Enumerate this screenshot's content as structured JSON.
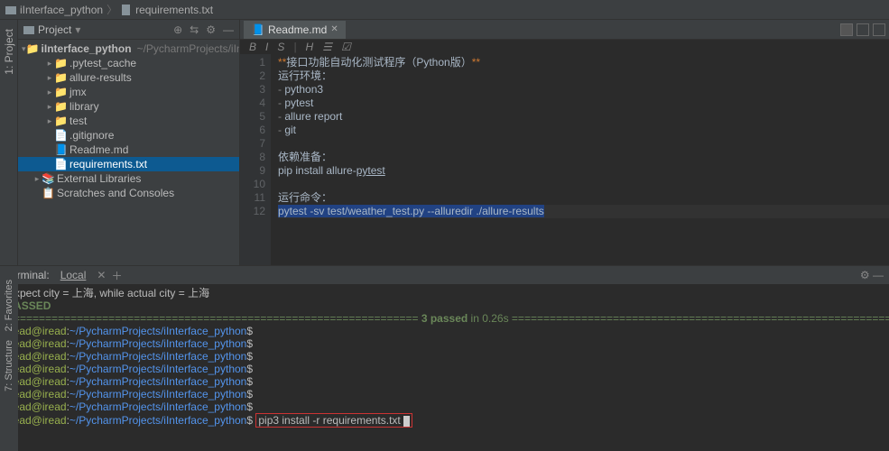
{
  "breadcrumb": {
    "root": "iInterface_python",
    "file": "requirements.txt"
  },
  "projectPane": {
    "title": "Project",
    "root": {
      "name": "iInterface_python",
      "path": "~/PycharmProjects/iInterface_pyt"
    },
    "nodes": [
      {
        "depth": 1,
        "arrow": "▸",
        "icon": "📁",
        "label": ".pytest_cache"
      },
      {
        "depth": 1,
        "arrow": "▸",
        "icon": "📁",
        "label": "allure-results"
      },
      {
        "depth": 1,
        "arrow": "▸",
        "icon": "📁",
        "label": "jmx"
      },
      {
        "depth": 1,
        "arrow": "▸",
        "icon": "📁",
        "label": "library"
      },
      {
        "depth": 1,
        "arrow": "▸",
        "icon": "📁",
        "label": "test"
      },
      {
        "depth": 1,
        "arrow": "",
        "icon": "📄",
        "label": ".gitignore"
      },
      {
        "depth": 1,
        "arrow": "",
        "icon": "📘",
        "label": "Readme.md"
      },
      {
        "depth": 1,
        "arrow": "",
        "icon": "📄",
        "label": "requirements.txt",
        "sel": true
      },
      {
        "depth": 0,
        "arrow": "▸",
        "icon": "📚",
        "label": "External Libraries",
        "ext": true
      },
      {
        "depth": 0,
        "arrow": "",
        "icon": "📋",
        "label": "Scratches and Consoles",
        "ext": true
      }
    ]
  },
  "leftTabs": {
    "top": "1: Project",
    "bottom": [
      "2: Favorites",
      "7: Structure"
    ]
  },
  "editor": {
    "tab": {
      "icon": "📘",
      "name": "Readme.md"
    },
    "toolbar": [
      "B",
      "I",
      "S",
      "H",
      "☰",
      "☑"
    ],
    "lines": [
      {
        "n": 1,
        "raw": "**接口功能自动化测试程序（Python版）**"
      },
      {
        "n": 2,
        "raw": "运行环境："
      },
      {
        "n": 3,
        "raw": "- python3"
      },
      {
        "n": 4,
        "raw": "- pytest"
      },
      {
        "n": 5,
        "raw": "- allure report"
      },
      {
        "n": 6,
        "raw": "- git"
      },
      {
        "n": 7,
        "raw": ""
      },
      {
        "n": 8,
        "raw": "依赖准备："
      },
      {
        "n": 9,
        "raw": "pip install allure-pytest"
      },
      {
        "n": 10,
        "raw": ""
      },
      {
        "n": 11,
        "raw": "运行命令："
      },
      {
        "n": 12,
        "raw": "pytest -sv test/weather_test.py --alluredir ./allure-results",
        "hl": true,
        "sel": true
      }
    ]
  },
  "terminal": {
    "title": "Terminal:",
    "tab": "Local",
    "lines": {
      "expect": "Expect city = 上海, while actual city = 上海",
      "passed": "PASSED",
      "summary_pre": "================================================================= ",
      "summary": "3 passed",
      "summary_time": " in 0.26s",
      "summary_post": " =================================================================",
      "user": "iread@iread",
      "path": "~/PycharmProjects/iInterface_python",
      "cmd": "pip3 install -r requirements.txt"
    },
    "emptyPrompts": 7
  }
}
